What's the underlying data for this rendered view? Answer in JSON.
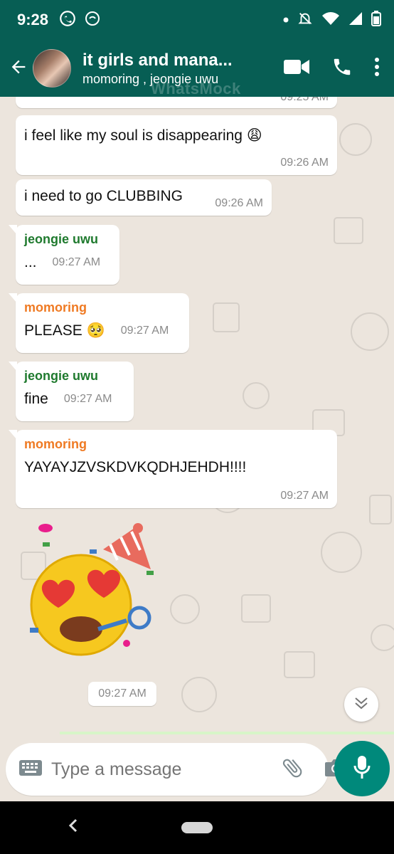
{
  "status_bar": {
    "time": "9:28"
  },
  "header": {
    "title": "it girls and mana...",
    "subtitle": "momoring , jeongie uwu",
    "watermark": "WhatsMock"
  },
  "messages": [
    {
      "type": "plain",
      "text": "",
      "time": "09:25 AM"
    },
    {
      "type": "plain",
      "text": "i feel like my soul is disappearing 😩",
      "time": "09:26 AM"
    },
    {
      "type": "plain",
      "text": "i need to go CLUBBING",
      "time": "09:26 AM"
    },
    {
      "type": "group",
      "sender": "jeongie uwu",
      "text": "...",
      "time": "09:27 AM"
    },
    {
      "type": "group",
      "sender": "momoring",
      "text": "PLEASE 🥺",
      "time": "09:27 AM"
    },
    {
      "type": "group",
      "sender": "jeongie uwu",
      "text": "fine",
      "time": "09:27 AM"
    },
    {
      "type": "group",
      "sender": "momoring",
      "text": "YAYAYJZVSKDVKQDHJEHDH!!!!",
      "time": "09:27 AM"
    },
    {
      "type": "sticker",
      "time": "09:27 AM"
    }
  ],
  "input": {
    "placeholder": "Type a message"
  },
  "colors": {
    "header": "#075E54",
    "sender_green": "#1f7a2e",
    "sender_orange": "#ef7a23",
    "mic": "#00897B"
  },
  "icons": {
    "status": [
      "whatsapp-icon",
      "signal-app-icon",
      "dot-icon",
      "notifications-off-icon",
      "wifi-icon",
      "cell-signal-icon",
      "battery-icon"
    ],
    "header": [
      "back-arrow-icon",
      "video-call-icon",
      "phone-icon",
      "more-vert-icon"
    ],
    "input": [
      "keyboard-icon",
      "paperclip-icon",
      "camera-icon",
      "mic-icon"
    ]
  }
}
